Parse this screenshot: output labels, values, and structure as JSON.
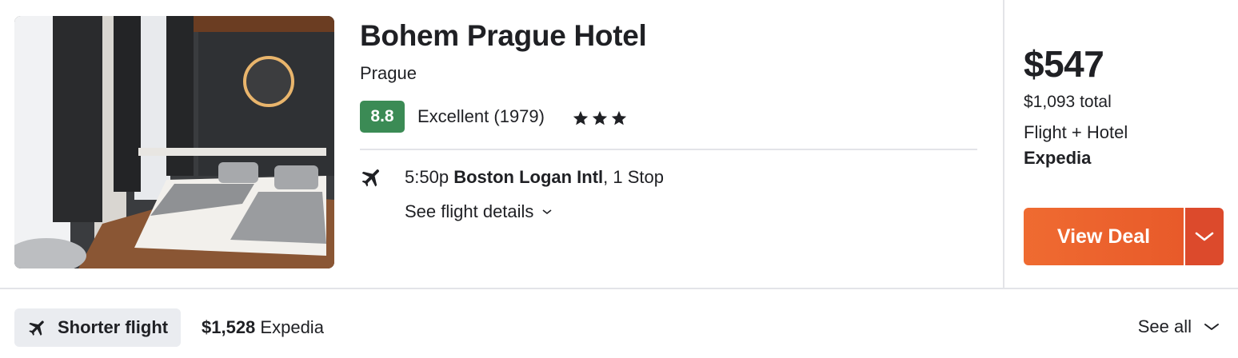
{
  "hotel": {
    "name": "Bohem Prague Hotel",
    "city": "Prague",
    "score": "8.8",
    "rating_text": "Excellent (1979)",
    "stars": 3
  },
  "flight": {
    "time": "5:50p",
    "airport": "Boston Logan Intl",
    "stops": ", 1 Stop",
    "details_link": "See flight details"
  },
  "pricing": {
    "price": "$547",
    "total": "$1,093 total",
    "package": "Flight + Hotel",
    "provider": "Expedia",
    "cta": "View Deal"
  },
  "alternative": {
    "tag": "Shorter flight",
    "price": "$1,528",
    "provider": "Expedia",
    "see_all": "See all"
  },
  "colors": {
    "score_bg": "#3b8b55",
    "cta_orange": "#ef6b31",
    "cta_dropdown": "#dc4a2c",
    "tag_bg": "#eaecf0"
  },
  "icons": {
    "plane": "airplane-icon",
    "star": "star-icon",
    "chevron": "chevron-down-icon"
  }
}
